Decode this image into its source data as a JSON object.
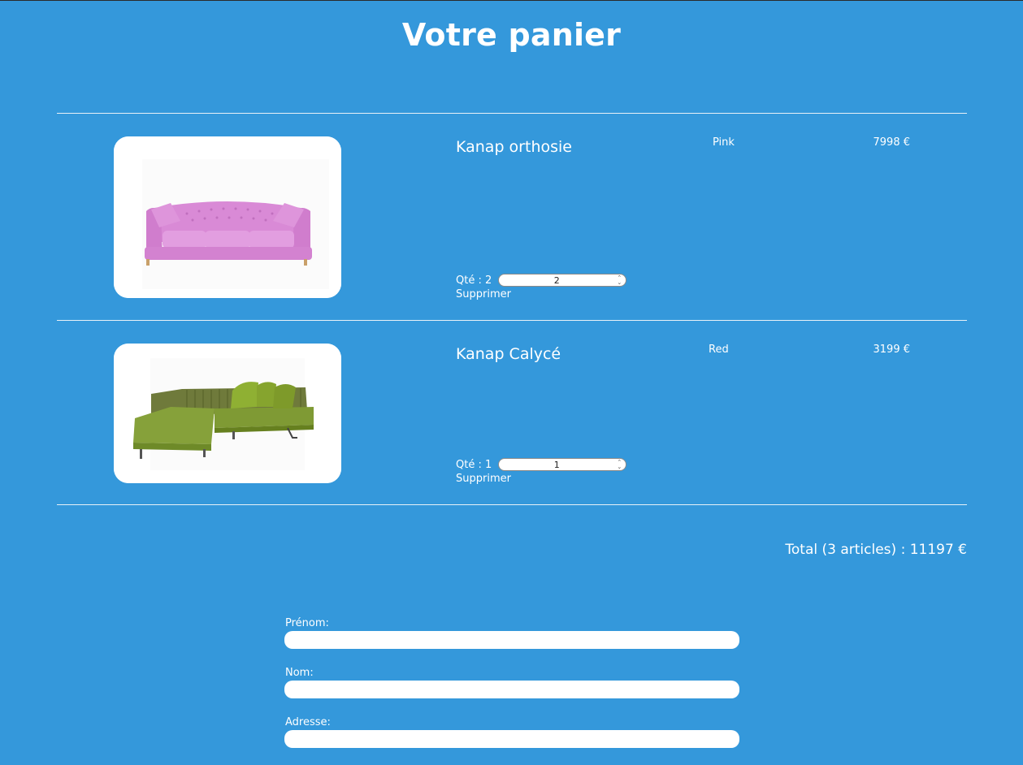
{
  "page": {
    "title": "Votre panier"
  },
  "cart": {
    "items": [
      {
        "name": "Kanap orthosie",
        "color": "Pink",
        "price": "7998 €",
        "qty_label": "Qté : 2",
        "qty_value": "2",
        "delete_label": "Supprimer",
        "image_icon": "pink-sofa-image"
      },
      {
        "name": "Kanap Calycé",
        "color": "Red",
        "price": "3199 €",
        "qty_label": "Qté : 1",
        "qty_value": "1",
        "delete_label": "Supprimer",
        "image_icon": "green-corner-sofa-image"
      }
    ],
    "total": "Total (3 articles) : 11197 €"
  },
  "form": {
    "first_name_label": "Prénom:",
    "last_name_label": "Nom:",
    "address_label": "Adresse:"
  },
  "colors": {
    "background": "#3498db",
    "text": "#ffffff"
  }
}
